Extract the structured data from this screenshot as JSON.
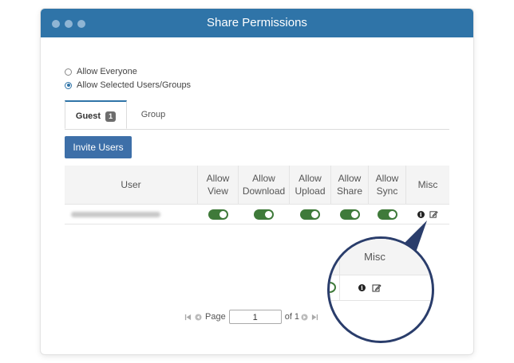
{
  "window": {
    "title": "Share Permissions"
  },
  "access": {
    "options": [
      {
        "label": "Allow Everyone",
        "checked": false
      },
      {
        "label": "Allow Selected Users/Groups",
        "checked": true
      }
    ]
  },
  "tabs": [
    {
      "label": "Guest",
      "badge": "1",
      "active": true
    },
    {
      "label": "Group",
      "active": false
    }
  ],
  "invite_label": "Invite Users",
  "table": {
    "headers": [
      "User",
      "Allow View",
      "Allow Download",
      "Allow Upload",
      "Allow Share",
      "Allow Sync",
      "Misc"
    ],
    "rows": [
      {
        "user": "(redacted)",
        "view": true,
        "download": true,
        "upload": true,
        "share": true,
        "sync": true
      }
    ]
  },
  "zoom": {
    "header": "Misc"
  },
  "pager": {
    "page_label": "Page",
    "page_value": "1",
    "of_label": "of 1"
  },
  "colors": {
    "titlebar": "#2f74a8",
    "toggle_on": "#3f7a3a",
    "button": "#3d6fa8",
    "zoom_border": "#2a3d6b"
  },
  "icons": [
    "info-icon",
    "edit-icon",
    "first-page-icon",
    "prev-page-icon",
    "next-page-icon",
    "last-page-icon"
  ]
}
